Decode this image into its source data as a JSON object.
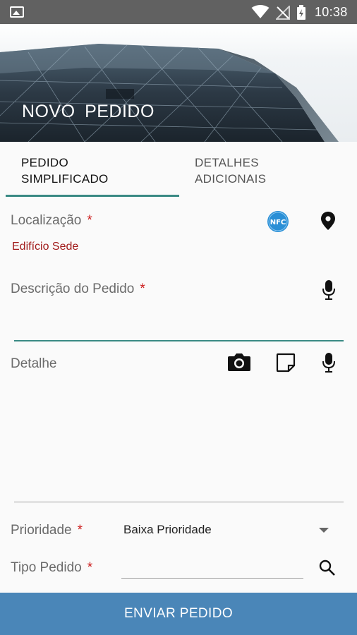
{
  "status_bar": {
    "time": "10:38"
  },
  "header": {
    "title": "NOVO  PEDIDO"
  },
  "tabs": [
    {
      "label_line1": "PEDIDO",
      "label_line2": "SIMPLIFICADO",
      "selected": true
    },
    {
      "label_line1": "DETALHES",
      "label_line2": "ADICIONAIS",
      "selected": false
    }
  ],
  "form": {
    "localizacao": {
      "label": "Localização",
      "required_mark": "*",
      "value": "Edifício Sede"
    },
    "descricao": {
      "label": "Descrição do Pedido",
      "required_mark": "*",
      "value": ""
    },
    "detalhe": {
      "label": "Detalhe",
      "value": ""
    },
    "prioridade": {
      "label": "Prioridade",
      "required_mark": "*",
      "selected": "Baixa Prioridade"
    },
    "tipo_pedido": {
      "label": "Tipo Pedido",
      "required_mark": "*",
      "value": ""
    },
    "nfc_badge": "NFC"
  },
  "submit_label": "ENVIAR PEDIDO",
  "colors": {
    "accent": "#3a8a84",
    "submit": "#4a86b8",
    "required": "#cc1b1b",
    "value_red": "#a11a1a",
    "statusbar": "#616161"
  },
  "icons": [
    "image-icon",
    "wifi-icon",
    "no-signal-icon",
    "battery-charging-icon",
    "nfc-icon",
    "location-pin-icon",
    "microphone-icon",
    "camera-icon",
    "note-icon",
    "chevron-down-icon",
    "search-icon"
  ]
}
